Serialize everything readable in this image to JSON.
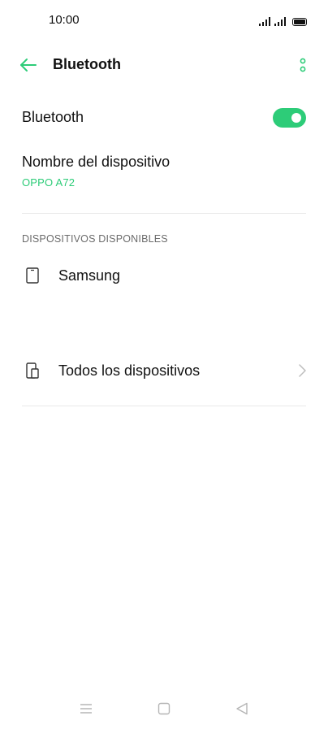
{
  "status_bar": {
    "time": "10:00"
  },
  "app_bar": {
    "title": "Bluetooth"
  },
  "bluetooth_toggle": {
    "label": "Bluetooth",
    "enabled": true
  },
  "device_name": {
    "label": "Nombre del dispositivo",
    "value": "OPPO A72"
  },
  "available_devices": {
    "header": "DISPOSITIVOS DISPONIBLES",
    "items": [
      {
        "label": "Samsung",
        "icon": "phone-icon"
      }
    ]
  },
  "all_devices": {
    "label": "Todos los dispositivos",
    "icon": "devices-icon"
  },
  "colors": {
    "accent": "#2dcc78",
    "divider": "#e8e8e8",
    "section_header": "#6b6b6b"
  },
  "nav_bar": {
    "icons": [
      "menu-icon",
      "home-icon",
      "back-triangle-icon"
    ]
  }
}
